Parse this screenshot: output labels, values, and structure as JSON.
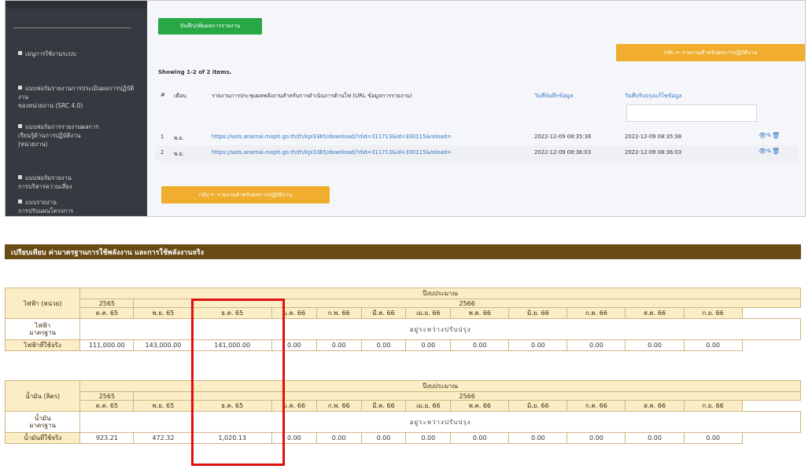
{
  "sidebar": {
    "items": [
      "เมนูการใช้งานระบบ",
      "แบบฟอร์มรายงานการประเมินผลการปฏิบัติงาน\nของหน่วยงาน (SRC 4.0)",
      "แบบฟอร์มการรายงานผลการ\nเรียนรู้ด้านการปฏิบัติงาน\n(หน่วยงาน)",
      "แบบฟอร์มรายงาน\nการบริหารความเสี่ยง",
      "แบบรายงาน\nการปรับแผนโครงการ"
    ]
  },
  "main": {
    "add_button": "บันทึก/เพิ่มผลการรายงาน",
    "back_button_top": "กลับ ← รายงานสำหรับผลการปฏิบัติงาน",
    "summary": "Showing 1-2 of 2 items.",
    "headers": {
      "num": "#",
      "month": "เดือน",
      "report": "รายงานการประชุมผลพลังงานสำหรับการดำเนินการด้านไฟ (URL ข้อมูลการรายงาน)",
      "created": "วันที่บันทึกข้อมูล",
      "updated": "วันที่ปรับปรุงแก้ไขข้อมูล"
    },
    "rows": [
      {
        "num": "1",
        "month": "พ.ย.",
        "url": "https://sats.anamai.moph.go.th/th/kpi3365/download/?did=311713&id=330115&reload=",
        "created": "2022-12-09 08:35:38",
        "updated": "2022-12-09 08:35:38",
        "actions": "👁✎🗑"
      },
      {
        "num": "2",
        "month": "พ.ย.",
        "url": "https://sats.anamai.moph.go.th/th/kpi3365/download/?did=311713&id=330115&reload=",
        "created": "2022-12-09 08:36:03",
        "updated": "2022-12-09 08:36:03",
        "actions": "👁✎🗑"
      }
    ],
    "back_button_bottom": "กลับ ← รายงานสำหรับผลการปฏิบัติงาน"
  },
  "compare_header": "เปรียบเทียบ ค่ามาตรฐานการใช้พลังงาน และการใช้พลังงานจริง",
  "tables": [
    {
      "label": "ไฟฟ้า (หน่วย)",
      "budget_title": "ปีงบประมาณ",
      "year_prev": "2565",
      "year_cur": "2566",
      "months": [
        "ต.ค. 65",
        "พ.ย. 65",
        "ธ.ค. 65",
        "ม.ค. 66",
        "ก.พ. 66",
        "มี.ค. 66",
        "เม.ย. 66",
        "พ.ค. 66",
        "มิ.ย. 66",
        "ก.ค. 66",
        "ส.ค. 66",
        "ก.ย. 66"
      ],
      "std_label": "ไฟฟ้า\nมาตรฐาน",
      "std_text": "อยู่ระหว่างปรับปรุง",
      "actual_label": "ไฟฟ้าที่ใช้จริง",
      "values": [
        "111,000.00",
        "143,000.00",
        "141,000.00",
        "0.00",
        "0.00",
        "0.00",
        "0.00",
        "0.00",
        "0.00",
        "0.00",
        "0.00",
        "0.00"
      ]
    },
    {
      "label": "น้ำมัน (ลิตร)",
      "budget_title": "ปีงบประมาณ",
      "year_prev": "2565",
      "year_cur": "2566",
      "months": [
        "ต.ค. 65",
        "พ.ย. 65",
        "ธ.ค. 65",
        "ม.ค. 66",
        "ก.พ. 66",
        "มี.ค. 66",
        "เม.ย. 66",
        "พ.ค. 66",
        "มิ.ย. 66",
        "ก.ค. 66",
        "ส.ค. 66",
        "ก.ย. 66"
      ],
      "std_label": "น้ำมัน\nมาตรฐาน",
      "std_text": "อยู่ระหว่างปรับปรุง",
      "actual_label": "น้ำมันที่ใช้จริง",
      "values": [
        "923.21",
        "472.32",
        "1,020.13",
        "0.00",
        "0.00",
        "0.00",
        "0.00",
        "0.00",
        "0.00",
        "0.00",
        "0.00",
        "0.00"
      ]
    }
  ],
  "colors": {
    "sidebar_bg": "#343a40",
    "green": "#28a745",
    "orange": "#f0ad2e",
    "brown": "#6b4b14",
    "table_label_bg": "#fbeec7",
    "highlight": "#e01010"
  }
}
